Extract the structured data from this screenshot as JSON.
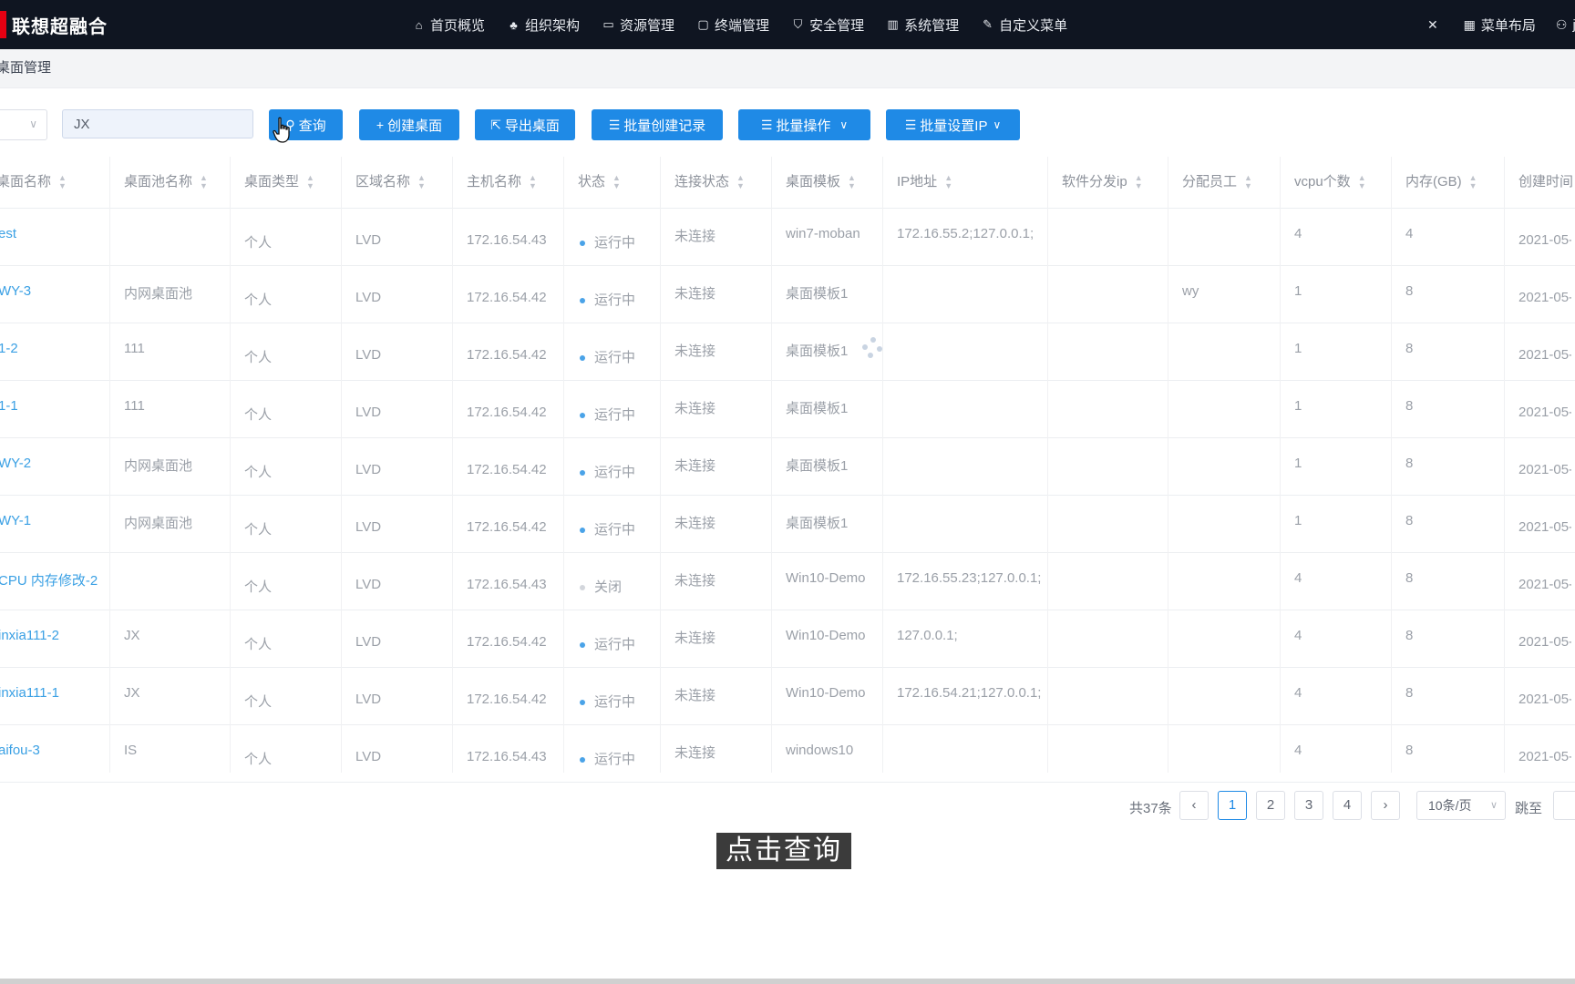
{
  "brand": {
    "name": "联想超融合",
    "color": "#e60012"
  },
  "nav": [
    {
      "icon": "home-icon",
      "label": "首页概览"
    },
    {
      "icon": "org-chart-icon",
      "label": "组织架构"
    },
    {
      "icon": "monitor-icon",
      "label": "资源管理"
    },
    {
      "icon": "devices-icon",
      "label": "终端管理"
    },
    {
      "icon": "shield-icon",
      "label": "安全管理"
    },
    {
      "icon": "grid-icon",
      "label": "系统管理"
    },
    {
      "icon": "edit-menu-icon",
      "label": "自定义菜单"
    }
  ],
  "topright": {
    "menu_layout": "菜单布局",
    "user": "jinx"
  },
  "breadcrumb": "桌面管理",
  "toolbar": {
    "search_value": "JX",
    "query": "查询",
    "create": "创建桌面",
    "export": "导出桌面",
    "batch_record": "批量创建记录",
    "batch_ops": "批量操作",
    "batch_ip": "批量设置IP",
    "accent": "#1f8ae6"
  },
  "columns": [
    "桌面名称",
    "桌面池名称",
    "桌面类型",
    "区域名称",
    "主机名称",
    "状态",
    "连接状态",
    "桌面模板",
    "IP地址",
    "软件分发ip",
    "分配员工",
    "vcpu个数",
    "内存(GB)",
    "创建时间"
  ],
  "rows": [
    {
      "name": "est",
      "pool": "",
      "type": "个人",
      "area": "LVD",
      "host": "172.16.54.43",
      "status": "运行中",
      "on": true,
      "conn": "未连接",
      "tpl": "win7-moban",
      "ip": "172.16.55.2;127.0.0.1;",
      "swip": "",
      "staff": "",
      "vcpu": "4",
      "mem": "4",
      "created": "2021-05-"
    },
    {
      "name": "WY-3",
      "pool": "内网桌面池",
      "type": "个人",
      "area": "LVD",
      "host": "172.16.54.42",
      "status": "运行中",
      "on": true,
      "conn": "未连接",
      "tpl": "桌面模板1",
      "ip": "",
      "swip": "",
      "staff": "wy",
      "vcpu": "1",
      "mem": "8",
      "created": "2021-05-"
    },
    {
      "name": "1-2",
      "pool": "111",
      "type": "个人",
      "area": "LVD",
      "host": "172.16.54.42",
      "status": "运行中",
      "on": true,
      "conn": "未连接",
      "tpl": "桌面模板1",
      "ip": "",
      "swip": "",
      "staff": "",
      "vcpu": "1",
      "mem": "8",
      "created": "2021-05-"
    },
    {
      "name": "1-1",
      "pool": "111",
      "type": "个人",
      "area": "LVD",
      "host": "172.16.54.42",
      "status": "运行中",
      "on": true,
      "conn": "未连接",
      "tpl": "桌面模板1",
      "ip": "",
      "swip": "",
      "staff": "",
      "vcpu": "1",
      "mem": "8",
      "created": "2021-05-"
    },
    {
      "name": "WY-2",
      "pool": "内网桌面池",
      "type": "个人",
      "area": "LVD",
      "host": "172.16.54.42",
      "status": "运行中",
      "on": true,
      "conn": "未连接",
      "tpl": "桌面模板1",
      "ip": "",
      "swip": "",
      "staff": "",
      "vcpu": "1",
      "mem": "8",
      "created": "2021-05-"
    },
    {
      "name": "WY-1",
      "pool": "内网桌面池",
      "type": "个人",
      "area": "LVD",
      "host": "172.16.54.42",
      "status": "运行中",
      "on": true,
      "conn": "未连接",
      "tpl": "桌面模板1",
      "ip": "",
      "swip": "",
      "staff": "",
      "vcpu": "1",
      "mem": "8",
      "created": "2021-05-"
    },
    {
      "name": "CPU 内存修改-2",
      "pool": "",
      "type": "个人",
      "area": "LVD",
      "host": "172.16.54.43",
      "status": "关闭",
      "on": false,
      "conn": "未连接",
      "tpl": "Win10-Demo",
      "ip": "172.16.55.23;127.0.0.1;",
      "swip": "",
      "staff": "",
      "vcpu": "4",
      "mem": "8",
      "created": "2021-05-"
    },
    {
      "name": "inxia111-2",
      "pool": "JX",
      "type": "个人",
      "area": "LVD",
      "host": "172.16.54.42",
      "status": "运行中",
      "on": true,
      "conn": "未连接",
      "tpl": "Win10-Demo",
      "ip": "127.0.0.1;",
      "swip": "",
      "staff": "",
      "vcpu": "4",
      "mem": "8",
      "created": "2021-05-"
    },
    {
      "name": "inxia111-1",
      "pool": "JX",
      "type": "个人",
      "area": "LVD",
      "host": "172.16.54.42",
      "status": "运行中",
      "on": true,
      "conn": "未连接",
      "tpl": "Win10-Demo",
      "ip": "172.16.54.21;127.0.0.1;",
      "swip": "",
      "staff": "",
      "vcpu": "4",
      "mem": "8",
      "created": "2021-05-"
    },
    {
      "name": "aifou-3",
      "pool": "IS",
      "type": "个人",
      "area": "LVD",
      "host": "172.16.54.43",
      "status": "运行中",
      "on": true,
      "conn": "未连接",
      "tpl": "windows10",
      "ip": "",
      "swip": "",
      "staff": "",
      "vcpu": "4",
      "mem": "8",
      "created": "2021-05-"
    }
  ],
  "pagination": {
    "total": "共37条",
    "pages": [
      "1",
      "2",
      "3",
      "4"
    ],
    "current": "1",
    "size": "10条/页",
    "jump": "跳至"
  },
  "caption": "点击查询"
}
